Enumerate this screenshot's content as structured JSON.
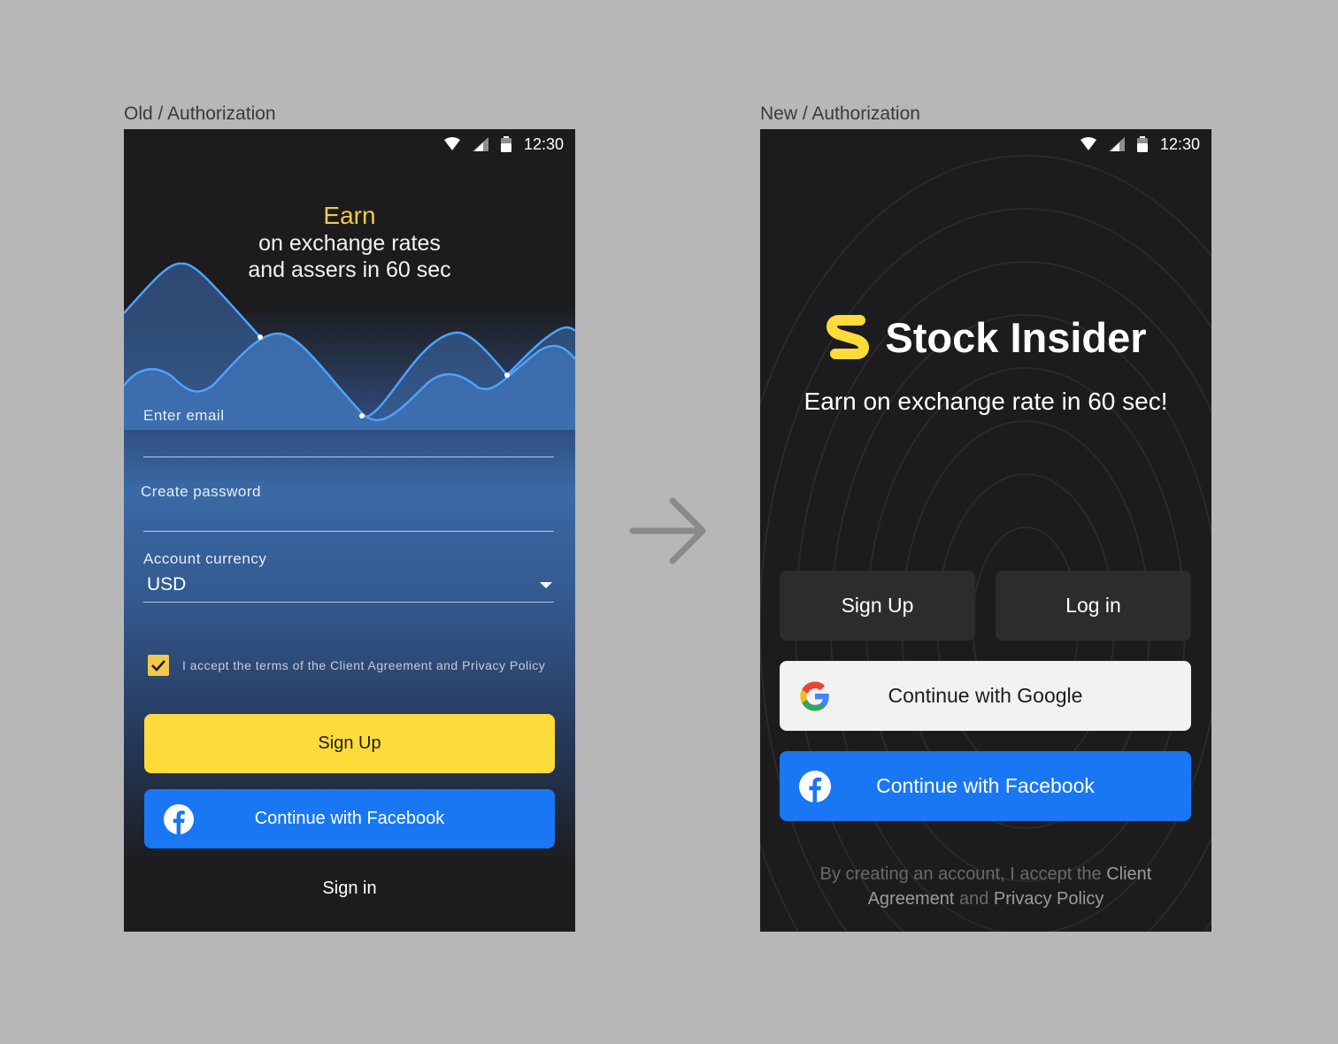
{
  "frames": {
    "old": {
      "title": "Old / Authorization"
    },
    "new": {
      "title": "New / Authorization"
    }
  },
  "status_bar": {
    "time": "12:30"
  },
  "old_screen": {
    "hero": {
      "accent": "Earn",
      "line1": "on exchange rates",
      "line2": "and assers in 60 sec"
    },
    "email_label": "Enter email",
    "password_label": "Create password",
    "currency_label": "Account currency",
    "currency_value": "USD",
    "terms_text": "I accept the terms of the Client Agreement and Privacy Policy",
    "signup_label": "Sign Up",
    "facebook_label": "Continue with Facebook",
    "signin_label": "Sign in"
  },
  "new_screen": {
    "brand_name": "Stock Insider",
    "tagline": "Earn on exchange rate in 60 sec!",
    "signup_label": "Sign Up",
    "login_label": "Log in",
    "google_label": "Continue with Google",
    "facebook_label": "Continue with Facebook",
    "legal": {
      "part1": "By creating an account, I accept the ",
      "link1": "Client Agreement",
      "part2": " and ",
      "link2": "Privacy Policy"
    }
  },
  "colors": {
    "accent_yellow": "#fddb3a",
    "facebook_blue": "#1977f3",
    "screen_bg": "#1c1c1e",
    "canvas_bg": "#b7b7b7"
  },
  "icons": [
    "wifi-icon",
    "signal-icon",
    "battery-icon",
    "check-icon",
    "caret-down-icon",
    "facebook-icon",
    "google-icon",
    "arrow-right-icon",
    "logo-icon"
  ]
}
